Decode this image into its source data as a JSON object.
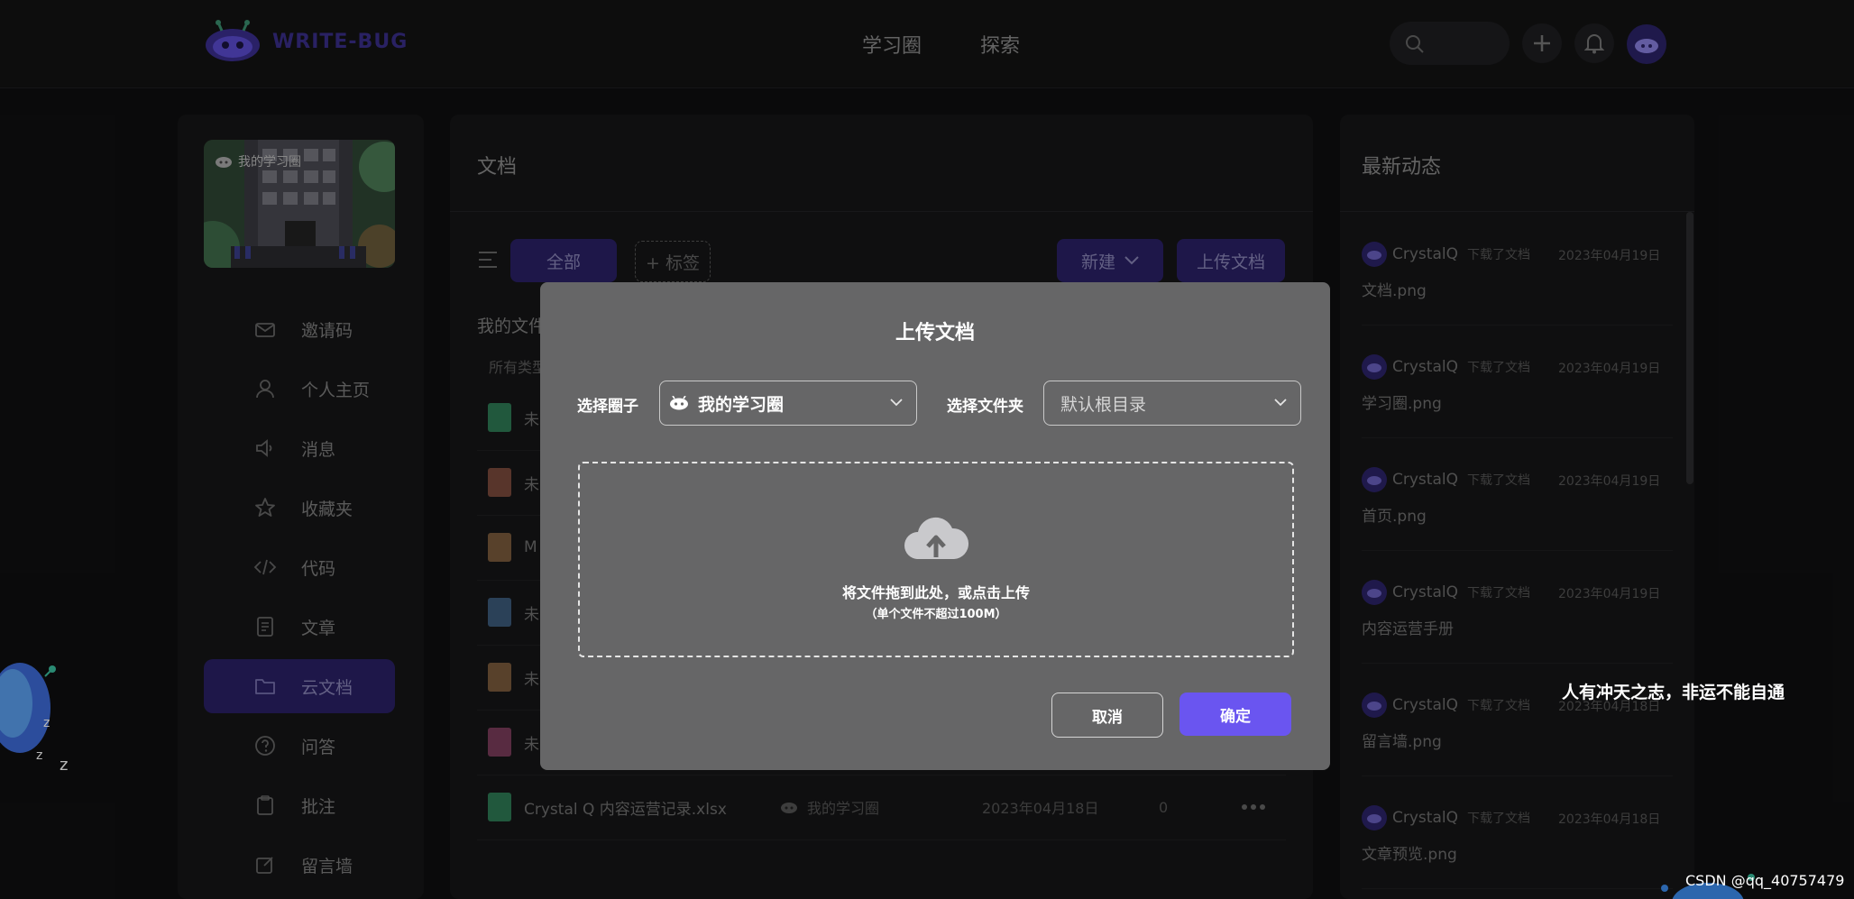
{
  "app": {
    "logo_text": "WRITE-BUG"
  },
  "nav": {
    "items": [
      "学习圈",
      "探索"
    ]
  },
  "header_icons": [
    "search-icon",
    "plus-icon",
    "bell-icon",
    "user-avatar"
  ],
  "sidebar": {
    "cover_label": "我的学习圈",
    "items": [
      {
        "label": "邀请码",
        "icon": "envelope-icon"
      },
      {
        "label": "个人主页",
        "icon": "user-icon"
      },
      {
        "label": "消息",
        "icon": "speaker-icon"
      },
      {
        "label": "收藏夹",
        "icon": "star-icon"
      },
      {
        "label": "代码",
        "icon": "code-icon"
      },
      {
        "label": "文章",
        "icon": "article-icon"
      },
      {
        "label": "云文档",
        "icon": "folder-icon",
        "active": true
      },
      {
        "label": "问答",
        "icon": "question-icon"
      },
      {
        "label": "批注",
        "icon": "clipboard-icon"
      },
      {
        "label": "留言墙",
        "icon": "edit-icon"
      }
    ]
  },
  "main": {
    "title": "文档",
    "filter_all": "全部",
    "add_tag": "+ 标签",
    "new_button": "新建",
    "upload_button": "上传文档",
    "section_title": "我的文件",
    "filter_type": "所有类型",
    "rows": [
      {
        "name": "未",
        "color": "#2f7a55"
      },
      {
        "name": "未",
        "color": "#7a4a3c"
      },
      {
        "name": "M",
        "color": "#7a5a3c"
      },
      {
        "name": "未",
        "color": "#3c5a7a"
      },
      {
        "name": "未",
        "color": "#7a5a3c"
      },
      {
        "name": "未",
        "color": "#7a3c5a"
      },
      {
        "name": "Crystal Q 内容运营记录.xlsx",
        "circle": "我的学习圈",
        "date": "2023年04月18日",
        "count": "0",
        "color": "#2f7a55"
      }
    ]
  },
  "activity": {
    "title": "最新动态",
    "items": [
      {
        "user": "CrystalQ",
        "action": "下载了文档",
        "date": "2023年04月19日",
        "file": "文档.png"
      },
      {
        "user": "CrystalQ",
        "action": "下载了文档",
        "date": "2023年04月19日",
        "file": "学习圈.png"
      },
      {
        "user": "CrystalQ",
        "action": "下载了文档",
        "date": "2023年04月19日",
        "file": "首页.png"
      },
      {
        "user": "CrystalQ",
        "action": "下载了文档",
        "date": "2023年04月19日",
        "file": "内容运营手册"
      },
      {
        "user": "CrystalQ",
        "action": "下载了文档",
        "date": "2023年04月18日",
        "file": "留言墙.png"
      },
      {
        "user": "CrystalQ",
        "action": "下载了文档",
        "date": "2023年04月18日",
        "file": "文章预览.png"
      }
    ]
  },
  "modal": {
    "title": "上传文档",
    "circle_label": "选择圈子",
    "circle_value": "我的学习圈",
    "folder_label": "选择文件夹",
    "folder_value": "默认根目录",
    "drop_text": "将文件拖到此处，或点击上传",
    "drop_hint": "（单个文件不超过100M）",
    "cancel": "取消",
    "confirm": "确定"
  },
  "overlay_quote": "人有冲天之志，非运不能自通",
  "watermark": "CSDN @qq_40757479",
  "colors": {
    "accent": "#6a55f0",
    "accent_dark": "#2c2368",
    "modal_bg": "#666667"
  }
}
